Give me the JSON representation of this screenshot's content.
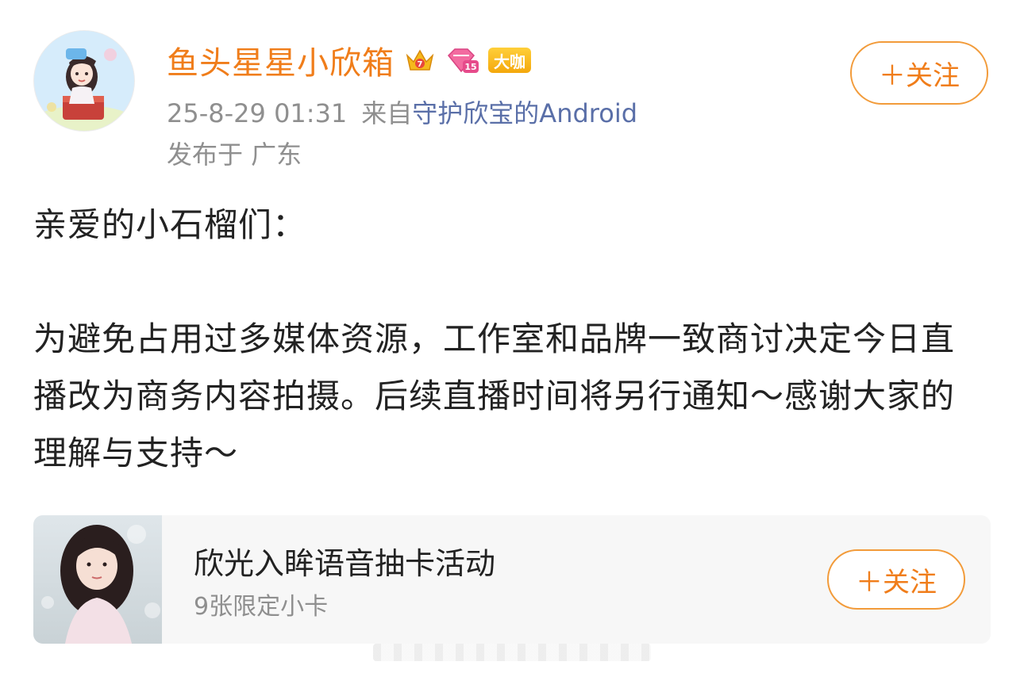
{
  "post": {
    "author": {
      "name": "鱼头星星小欣箱",
      "level_badge": "大咖",
      "crown_badge_number": "7",
      "diamond_badge_number": "15"
    },
    "timestamp": "25-8-29 01:31",
    "source_prefix": "来自",
    "source_device": "守护欣宝的Android",
    "location": "发布于 广东",
    "follow_label": "＋关注",
    "greeting": "亲爱的小石榴们：",
    "content": "为避免占用过多媒体资源，工作室和品牌一致商讨决定今日直播改为商务内容拍摄。后续直播时间将另行通知～感谢大家的理解与支持～"
  },
  "card": {
    "title": "欣光入眸语音抽卡活动",
    "subtitle": "9张限定小卡",
    "follow_label": "＋关注"
  },
  "colors": {
    "accent": "#f07d1a",
    "link": "#5a6fa8",
    "muted": "#8f8f8f",
    "card_bg": "#f7f7f7"
  },
  "icons": [
    "crown-badge-icon",
    "diamond-badge-icon"
  ]
}
